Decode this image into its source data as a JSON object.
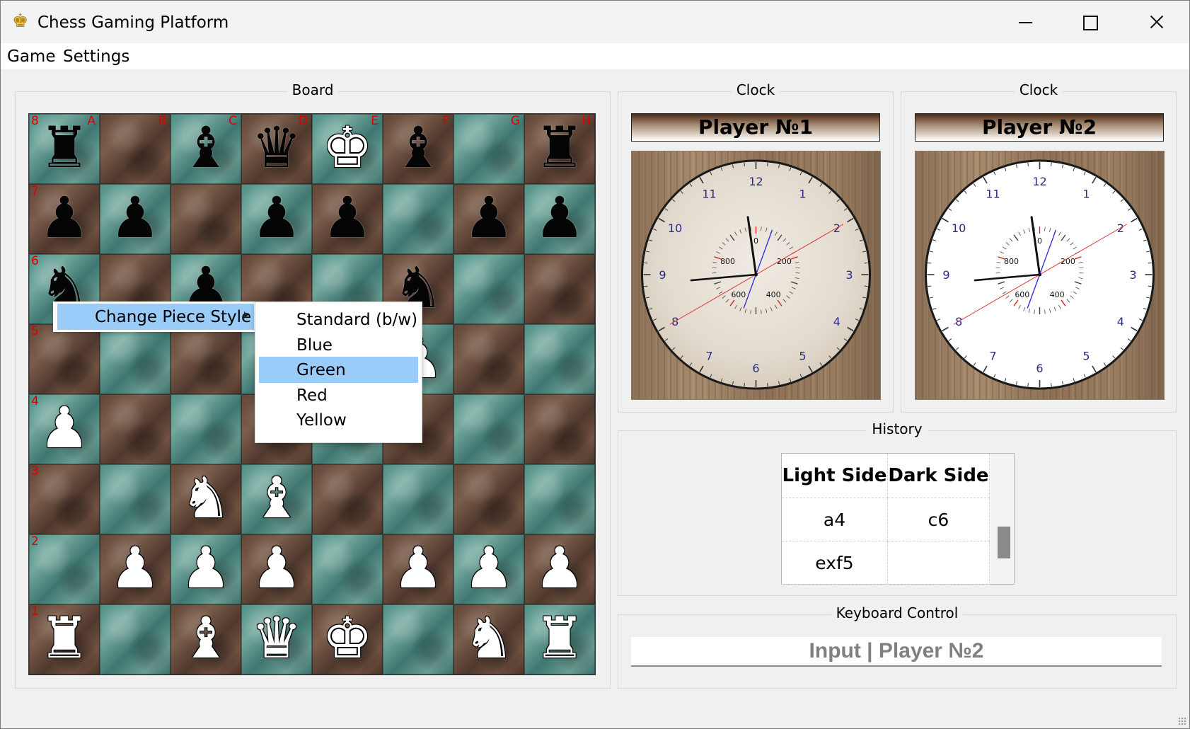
{
  "window": {
    "title": "Chess Gaming Platform",
    "app_icon": "crown-icon"
  },
  "menubar": {
    "items": [
      "Game",
      "Settings"
    ]
  },
  "board": {
    "group_title": "Board",
    "files": [
      "A",
      "B",
      "C",
      "D",
      "E",
      "F",
      "G",
      "H"
    ],
    "ranks": [
      "8",
      "7",
      "6",
      "5",
      "4",
      "3",
      "2",
      "1"
    ],
    "rows": [
      [
        "bR",
        "",
        "bB",
        "bQ",
        "wK",
        "bB",
        "",
        "bR"
      ],
      [
        "bP",
        "bP",
        "",
        "bP",
        "bP",
        "",
        "bP",
        "bP"
      ],
      [
        "bN",
        "",
        "bP",
        "",
        "",
        "bN",
        "",
        ""
      ],
      [
        "",
        "",
        "",
        "",
        "",
        "wP",
        "",
        ""
      ],
      [
        "wP",
        "",
        "",
        "",
        "",
        "",
        "",
        ""
      ],
      [
        "",
        "",
        "wN",
        "wB",
        "",
        "",
        "",
        ""
      ],
      [
        "",
        "wP",
        "wP",
        "wP",
        "",
        "wP",
        "wP",
        "wP"
      ],
      [
        "wR",
        "",
        "wB",
        "wQ",
        "wK",
        "",
        "wN",
        "wR"
      ]
    ]
  },
  "context_menu": {
    "item": "Change Piece Style",
    "submenu": [
      {
        "label": "Standard (b/w)",
        "selected": false
      },
      {
        "label": "Blue",
        "selected": false
      },
      {
        "label": "Green",
        "selected": true
      },
      {
        "label": "Red",
        "selected": false
      },
      {
        "label": "Yellow",
        "selected": false
      }
    ]
  },
  "clocks": [
    {
      "group_title": "Clock",
      "player": "Player №1",
      "face": "wood",
      "dial_numbers": [
        "12",
        "1",
        "2",
        "3",
        "4",
        "5",
        "6",
        "7",
        "8",
        "9",
        "10",
        "11"
      ],
      "sub_dial": [
        "0",
        "200",
        "400",
        "600",
        "800"
      ]
    },
    {
      "group_title": "Clock",
      "player": "Player №2",
      "face": "white",
      "dial_numbers": [
        "12",
        "1",
        "2",
        "3",
        "4",
        "5",
        "6",
        "7",
        "8",
        "9",
        "10",
        "11"
      ],
      "sub_dial": [
        "0",
        "200",
        "400",
        "600",
        "800"
      ]
    }
  ],
  "history": {
    "group_title": "History",
    "columns": [
      "Light Side",
      "Dark Side"
    ],
    "rows": [
      [
        "a4",
        "c6"
      ],
      [
        "exf5",
        ""
      ]
    ]
  },
  "keyboard": {
    "group_title": "Keyboard Control",
    "value": "Input | Player №2"
  },
  "colors": {
    "light_square": "#5f978d",
    "dark_square": "#674b3c",
    "menu_highlight": "#99ccf8",
    "coord_label": "#dd0000"
  }
}
